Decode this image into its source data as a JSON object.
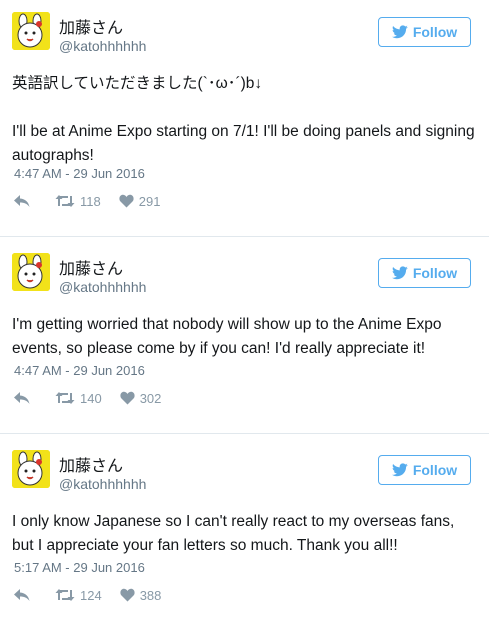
{
  "colors": {
    "accent": "#55acee",
    "text": "#14171a",
    "muted": "#657786",
    "icon": "#8899a6",
    "avatar_bg": "#f2e21a"
  },
  "tweets": [
    {
      "display_name": "加藤さん",
      "handle": "@katohhhhhh",
      "follow_label": "Follow",
      "text": "英語訳していただきました(`･ω･´)b↓\n\nI'll be at Anime Expo starting on 7/1! I'll be doing panels and signing autographs!",
      "timestamp": "4:47 AM - 29 Jun 2016",
      "retweets": "118",
      "likes": "291",
      "icons": {
        "reply": "reply-icon",
        "retweet": "retweet-icon",
        "like": "heart-icon",
        "follow": "twitter-bird-icon"
      }
    },
    {
      "display_name": "加藤さん",
      "handle": "@katohhhhhh",
      "follow_label": "Follow",
      "text": "I'm getting worried that nobody will show up to the Anime Expo events, so please come by if you can! I'd really appreciate it!",
      "timestamp": "4:47 AM - 29 Jun 2016",
      "retweets": "140",
      "likes": "302",
      "icons": {
        "reply": "reply-icon",
        "retweet": "retweet-icon",
        "like": "heart-icon",
        "follow": "twitter-bird-icon"
      }
    },
    {
      "display_name": "加藤さん",
      "handle": "@katohhhhhh",
      "follow_label": "Follow",
      "text": "I only know Japanese so I can't really react to my overseas fans, but I appreciate your fan letters so much. Thank you all!!",
      "timestamp": "5:17 AM - 29 Jun 2016",
      "retweets": "124",
      "likes": "388",
      "icons": {
        "reply": "reply-icon",
        "retweet": "retweet-icon",
        "like": "heart-icon",
        "follow": "twitter-bird-icon"
      }
    }
  ]
}
